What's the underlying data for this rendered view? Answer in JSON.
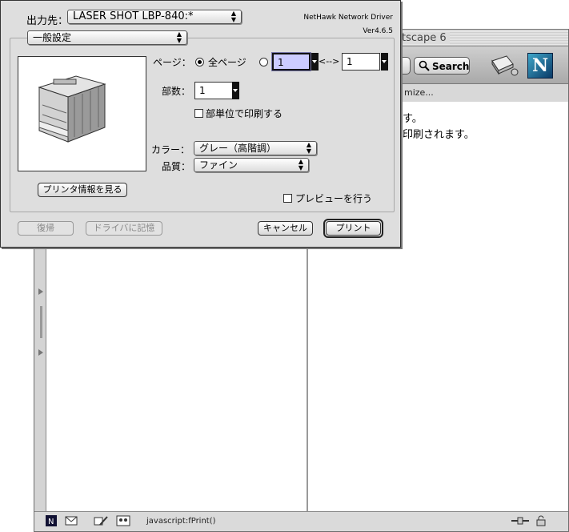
{
  "browser": {
    "title": "tscape 6",
    "search_label": "Search",
    "personal_toolbar_text": "mize...",
    "logo_letter": "N",
    "content_lines": [
      "す。",
      "印刷されます。"
    ],
    "status_text": "javascript:fPrint()"
  },
  "dialog": {
    "destination_label": "出力先：",
    "destination_value": "LASER SHOT LBP-840:*",
    "driver_name": "NetHawk Network Driver",
    "driver_version": "Ver4.6.5",
    "settings_panel": "一般設定",
    "pages_label": "ページ：",
    "all_pages_label": "全ページ",
    "page_from": "1",
    "range_separator": "<-->",
    "page_to": "1",
    "copies_label": "部数：",
    "copies_value": "1",
    "collate_label": "部単位で印刷する",
    "color_label": "カラー：",
    "color_value": "グレー（高階調）",
    "quality_label": "品質：",
    "quality_value": "ファイン",
    "printer_info_button": "プリンタ情報を見る",
    "preview_label": "プレビューを行う",
    "restore_button": "復帰",
    "save_driver_button": "ドライバに記憶",
    "cancel_button": "キャンセル",
    "print_button": "プリント"
  }
}
